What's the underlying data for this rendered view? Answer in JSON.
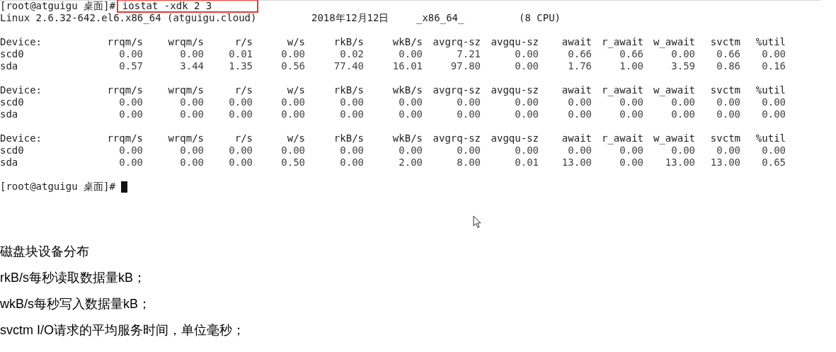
{
  "terminal": {
    "prompt": "[root@atguigu 桌面]#",
    "command": {
      "text": "iostat -xdk 2 3",
      "highlighted": true
    },
    "system_info": [
      "Linux 2.6.32-642.el6.x86_64 (atguigu.cloud)",
      "2018年12月12日",
      "_x86_64_",
      "(8 CPU)"
    ],
    "reports": [
      {
        "columns": [
          "Device:",
          "rrqm/s",
          "wrqm/s",
          "r/s",
          "w/s",
          "rkB/s",
          "wkB/s",
          "avgrq-sz",
          "avgqu-sz",
          "await",
          "r_await",
          "w_await",
          "svctm",
          "%util"
        ],
        "rows": [
          [
            "scd0",
            "0.00",
            "0.00",
            "0.01",
            "0.00",
            "0.02",
            "0.00",
            "7.21",
            "0.00",
            "0.66",
            "0.66",
            "0.00",
            "0.66",
            "0.00"
          ],
          [
            "sda",
            "0.57",
            "3.44",
            "1.35",
            "0.56",
            "77.40",
            "16.01",
            "97.80",
            "0.00",
            "1.76",
            "1.00",
            "3.59",
            "0.86",
            "0.16"
          ]
        ]
      },
      {
        "columns": [
          "Device:",
          "rrqm/s",
          "wrqm/s",
          "r/s",
          "w/s",
          "rkB/s",
          "wkB/s",
          "avgrq-sz",
          "avgqu-sz",
          "await",
          "r_await",
          "w_await",
          "svctm",
          "%util"
        ],
        "rows": [
          [
            "scd0",
            "0.00",
            "0.00",
            "0.00",
            "0.00",
            "0.00",
            "0.00",
            "0.00",
            "0.00",
            "0.00",
            "0.00",
            "0.00",
            "0.00",
            "0.00"
          ],
          [
            "sda",
            "0.00",
            "0.00",
            "0.00",
            "0.00",
            "0.00",
            "0.00",
            "0.00",
            "0.00",
            "0.00",
            "0.00",
            "0.00",
            "0.00",
            "0.00"
          ]
        ]
      },
      {
        "columns": [
          "Device:",
          "rrqm/s",
          "wrqm/s",
          "r/s",
          "w/s",
          "rkB/s",
          "wkB/s",
          "avgrq-sz",
          "avgqu-sz",
          "await",
          "r_await",
          "w_await",
          "svctm",
          "%util"
        ],
        "rows": [
          [
            "scd0",
            "0.00",
            "0.00",
            "0.00",
            "0.00",
            "0.00",
            "0.00",
            "0.00",
            "0.00",
            "0.00",
            "0.00",
            "0.00",
            "0.00",
            "0.00"
          ],
          [
            "sda",
            "0.00",
            "0.00",
            "0.00",
            "0.50",
            "0.00",
            "2.00",
            "8.00",
            "0.01",
            "13.00",
            "0.00",
            "13.00",
            "13.00",
            "0.65"
          ]
        ]
      }
    ],
    "final_prompt": "[root@atguigu 桌面]#"
  },
  "notes": [
    "磁盘块设备分布",
    "rkB/s每秒读取数据量kB；",
    "wkB/s每秒写入数据量kB；",
    "svctm I/O请求的平均服务时间，单位毫秒；"
  ]
}
